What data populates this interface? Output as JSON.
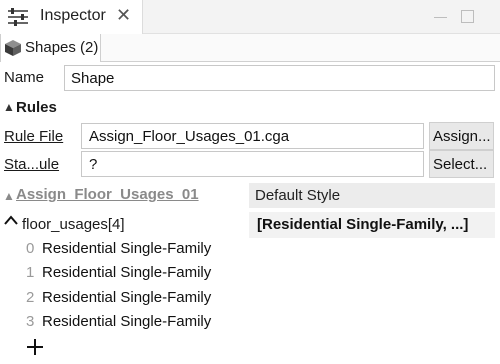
{
  "window": {
    "tab_title": "Inspector",
    "close_glyph": "✕"
  },
  "shapes_tab": {
    "label": "Shapes (2)"
  },
  "name_field": {
    "label": "Name",
    "value": "Shape"
  },
  "rules": {
    "header": "Rules",
    "rule_file_label": "Rule File",
    "rule_file_value": "Assign_Floor_Usages_01.cga",
    "assign_button": "Assign...",
    "start_rule_label": "Sta...ule",
    "start_rule_value": "?",
    "select_button": "Select..."
  },
  "rule_section": {
    "name": "Assign_Floor_Usages_01",
    "style_header": "Default Style"
  },
  "floor_usages": {
    "label": "floor_usages[4]",
    "value": "[Residential Single-Family, ...]",
    "items": [
      {
        "index": "0",
        "value": "Residential Single-Family"
      },
      {
        "index": "1",
        "value": "Residential Single-Family"
      },
      {
        "index": "2",
        "value": "Residential Single-Family"
      },
      {
        "index": "3",
        "value": "Residential Single-Family"
      }
    ]
  },
  "icons": {
    "tab_icon": "sliders-icon",
    "shape_icon": "cube-icon",
    "add": "plus-icon"
  },
  "colors": {
    "disabled_text": "#8a8a8a",
    "button_bg": "#e8e8e8",
    "header_bg": "#ececec"
  }
}
